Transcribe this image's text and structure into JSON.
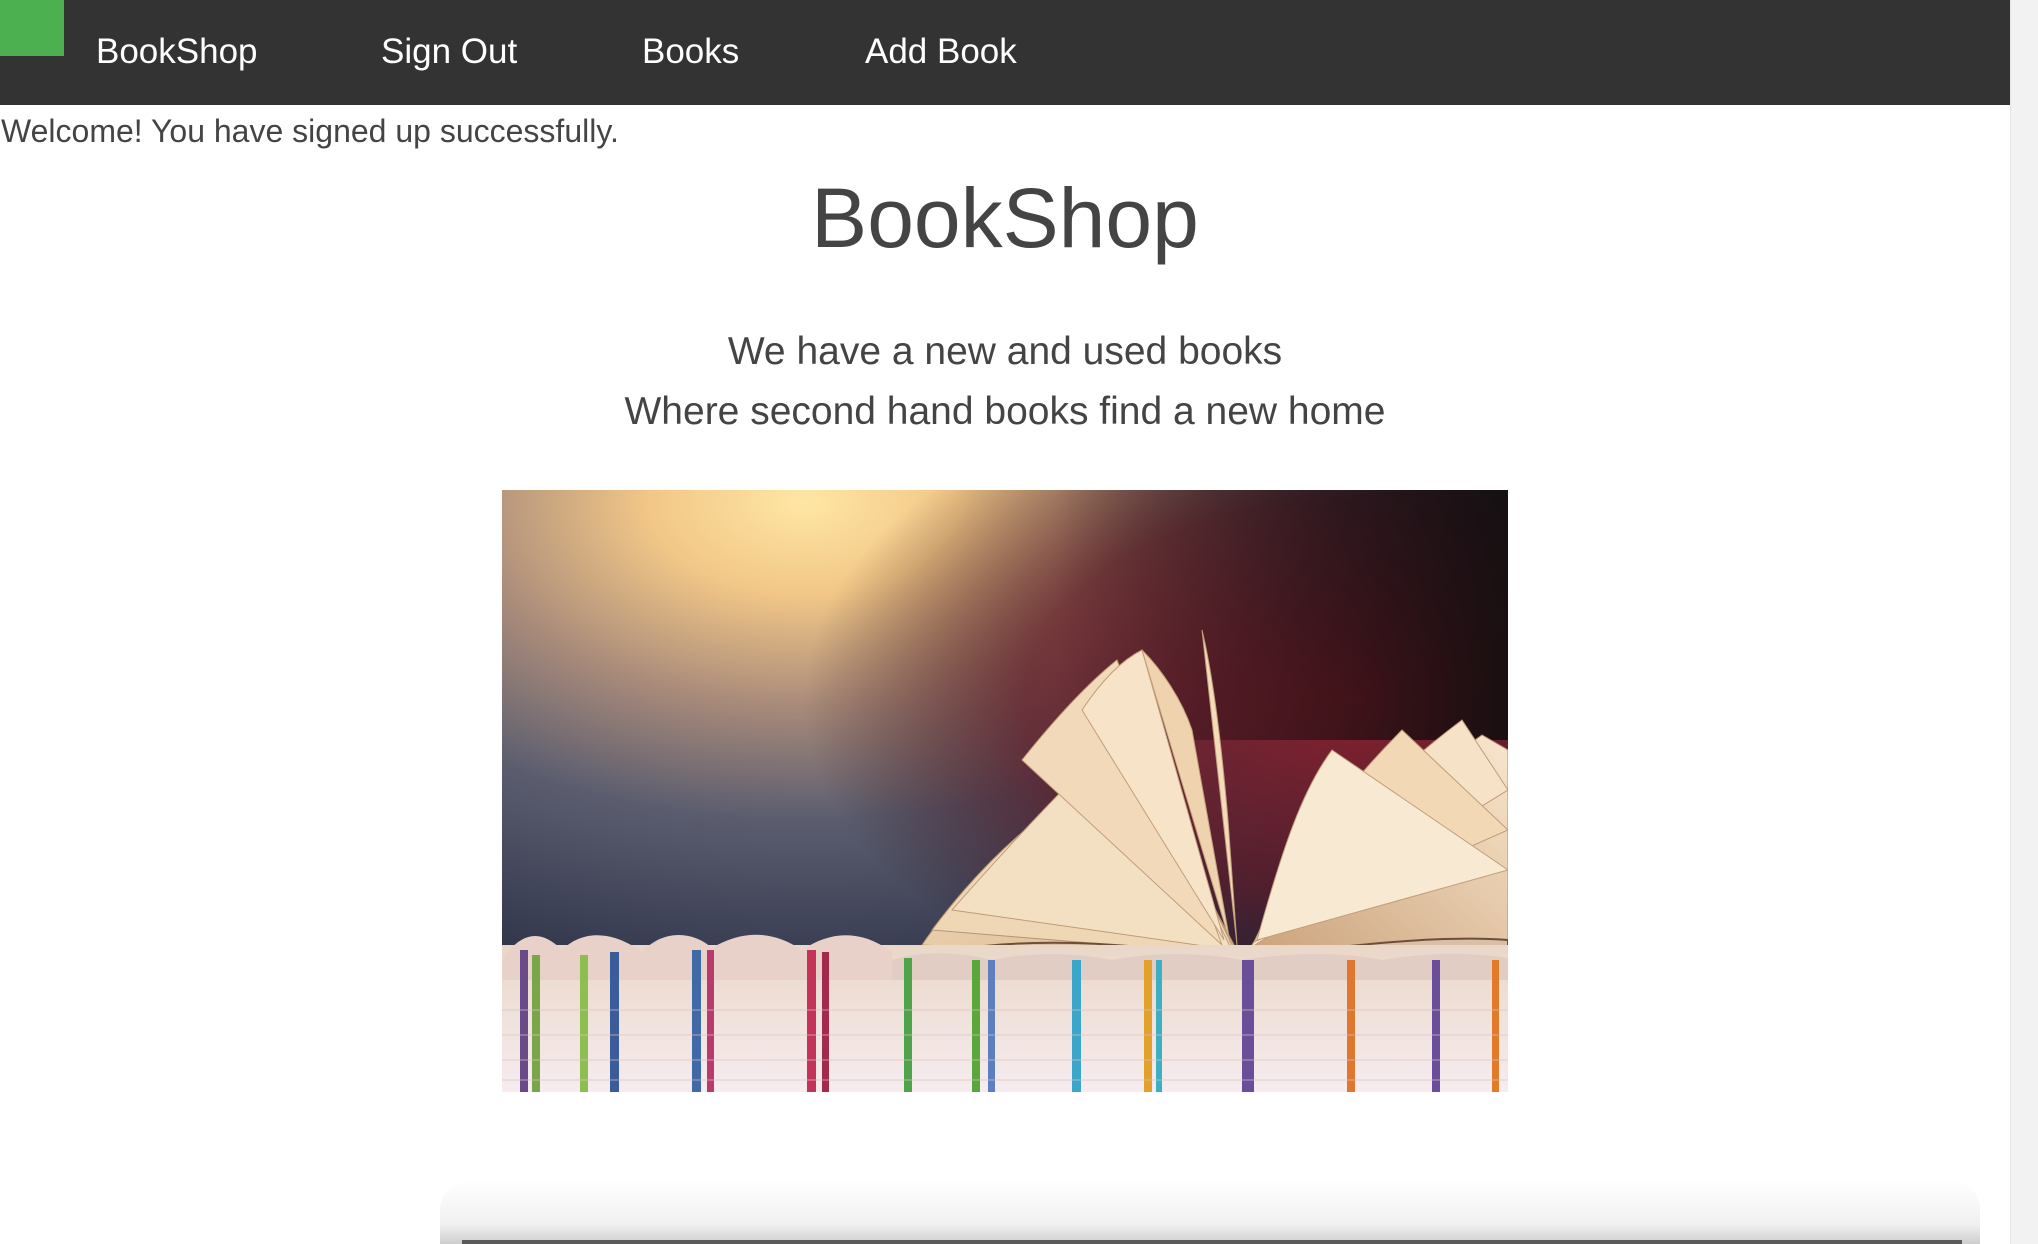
{
  "navbar": {
    "brand_label": "BookShop",
    "links": [
      {
        "label": "Sign Out"
      },
      {
        "label": "Books"
      },
      {
        "label": "Add Book"
      }
    ],
    "background_color": "#333333",
    "logo_color": "#4caf50"
  },
  "flash": {
    "message": "Welcome! You have signed up successfully."
  },
  "hero": {
    "title": "BookShop",
    "tagline_1": "We have a new and used books",
    "tagline_2": "Where second hand books find a new home",
    "image_icon": "open-book-on-books-photo"
  }
}
